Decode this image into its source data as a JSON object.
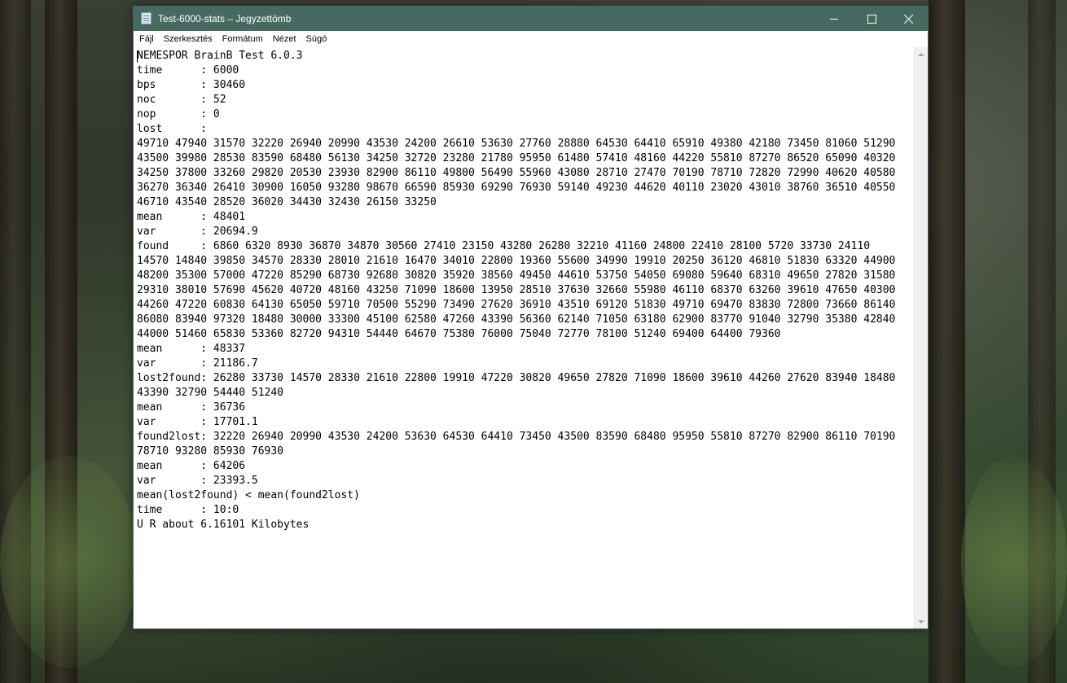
{
  "window": {
    "title": "Test-6000-stats – Jegyzettömb",
    "titlebar_color": "#466a5f"
  },
  "menu": {
    "items": [
      "Fájl",
      "Szerkesztés",
      "Formátum",
      "Nézet",
      "Súgó"
    ]
  },
  "document": {
    "lines": [
      "NEMESPOR BrainB Test 6.0.3",
      "time      : 6000",
      "bps       : 30460",
      "noc       : 52",
      "nop       : 0",
      "lost      :",
      "49710 47940 31570 32220 26940 20990 43530 24200 26610 53630 27760 28880 64530 64410 65910 49380 42180 73450 81060 51290",
      "43500 39980 28530 83590 68480 56130 34250 32720 23280 21780 95950 61480 57410 48160 44220 55810 87270 86520 65090 40320",
      "34250 37800 33260 29820 20530 23930 82900 86110 49800 56490 55960 43080 28710 27470 70190 78710 72820 72990 40620 40580",
      "36270 36340 26410 30900 16050 93280 98670 66590 85930 69290 76930 59140 49230 44620 40110 23020 43010 38760 36510 40550",
      "46710 43540 28520 36020 34430 32430 26150 33250",
      "mean      : 48401",
      "var       : 20694.9",
      "found     : 6860 6320 8930 36870 34870 30560 27410 23150 43280 26280 32210 41160 24800 22410 28100 5720 33730 24110",
      "14570 14840 39850 34570 28330 28010 21610 16470 34010 22800 19360 55600 34990 19910 20250 36120 46810 51830 63320 44900",
      "48200 35300 57000 47220 85290 68730 92680 30820 35920 38560 49450 44610 53750 54050 69080 59640 68310 49650 27820 31580",
      "29310 38010 57690 45620 40720 48160 43250 71090 18600 13950 28510 37630 32660 55980 46110 68370 63260 39610 47650 40300",
      "44260 47220 60830 64130 65050 59710 70500 55290 73490 27620 36910 43510 69120 51830 49710 69470 83830 72800 73660 86140",
      "86080 83940 97320 18480 30000 33300 45100 62580 47260 43390 56360 62140 71050 63180 62900 83770 91040 32790 35380 42840",
      "44000 51460 65830 53360 82720 94310 54440 64670 75380 76000 75040 72770 78100 51240 69400 64400 79360",
      "mean      : 48337",
      "var       : 21186.7",
      "lost2found: 26280 33730 14570 28330 21610 22800 19910 47220 30820 49650 27820 71090 18600 39610 44260 27620 83940 18480",
      "43390 32790 54440 51240",
      "mean      : 36736",
      "var       : 17701.1",
      "found2lost: 32220 26940 20990 43530 24200 53630 64530 64410 73450 43500 83590 68480 95950 55810 87270 82900 86110 70190",
      "78710 93280 85930 76930",
      "mean      : 64206",
      "var       : 23393.5",
      "mean(lost2found) < mean(found2lost)",
      "time      : 10:0",
      "U R about 6.16101 Kilobytes"
    ]
  }
}
